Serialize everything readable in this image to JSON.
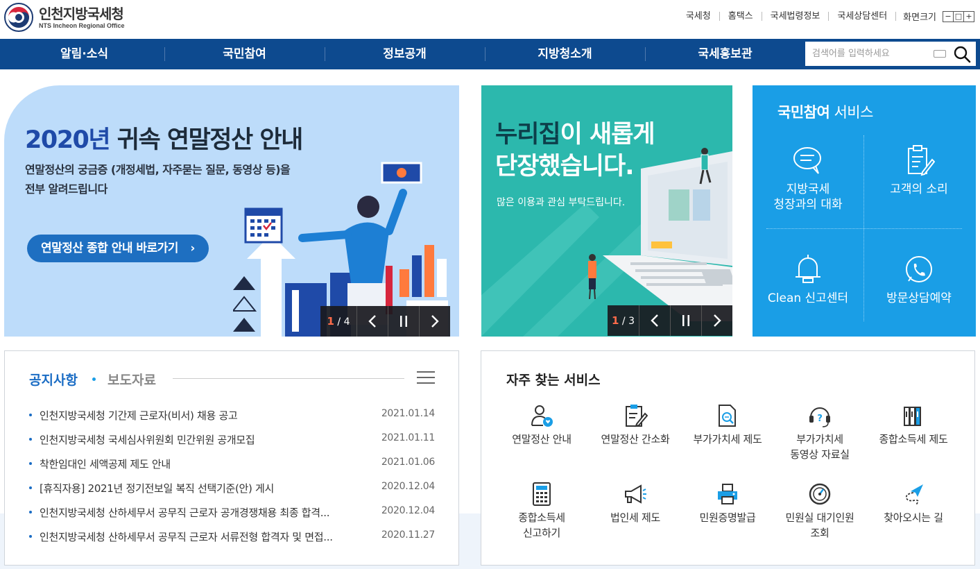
{
  "header": {
    "logo_title": "인천지방국세청",
    "logo_sub": "NTS Incheon Regional Office",
    "util_links": [
      "국세청",
      "홈택스",
      "국세법령정보",
      "국세상담센터"
    ],
    "font_size_label": "화면크기",
    "zoom_out": "−",
    "zoom_reset": "□",
    "zoom_in": "+"
  },
  "nav": {
    "items": [
      "알림·소식",
      "국민참여",
      "정보공개",
      "지방청소개",
      "국세홍보관"
    ],
    "search_placeholder": "검색어를 입력하세요"
  },
  "banner_main": {
    "title_year": "2020년",
    "title_rest": " 귀속 연말정산 안내",
    "desc_line1": "연말정산의 궁금증 (개정세법, 자주묻는 질문, 동영상 등)을",
    "desc_line2": "전부 알려드립니다",
    "button": "연말정산 종합 안내 바로가기",
    "page_current": "1",
    "page_total": "/ 4"
  },
  "banner_second": {
    "title_hl": "누리집",
    "title_rest1": "이 새롭게",
    "title_line2": "단장했습니다.",
    "desc": "많은 이용과 관심 부탁드립니다.",
    "page_current": "1",
    "page_total": "/ 3"
  },
  "service_box": {
    "title_bold": "국민참여",
    "title_rest": " 서비스",
    "items": [
      {
        "line1": "지방국세",
        "line2": "청장과의 대화",
        "icon": "speech-bubble-icon"
      },
      {
        "line1": "고객의 소리",
        "line2": "",
        "icon": "clipboard-pen-icon"
      },
      {
        "line1": "Clean 신고센터",
        "line2": "",
        "icon": "bell-icon"
      },
      {
        "line1": "방문상담예약",
        "line2": "",
        "icon": "phone-chat-icon"
      }
    ]
  },
  "notice": {
    "tab_active": "공지사항",
    "tab_inactive": "보도자료",
    "items": [
      {
        "title": "인천지방국세청 기간제 근로자(비서) 채용 공고",
        "date": "2021.01.14"
      },
      {
        "title": "인천지방국세청 국세심사위원회 민간위원 공개모집",
        "date": "2021.01.11"
      },
      {
        "title": "착한임대인 세액공제 제도 안내",
        "date": "2021.01.06"
      },
      {
        "title": "[휴직자용] 2021년 정기전보일 복직 선택기준(안) 게시",
        "date": "2020.12.04"
      },
      {
        "title": "인천지방국세청 산하세무서 공무직 근로자 공개경쟁채용 최종 합격...",
        "date": "2020.12.04"
      },
      {
        "title": "인천지방국세청 산하세무서 공무직 근로자 서류전형 합격자 및 면접...",
        "date": "2020.11.27"
      }
    ]
  },
  "frequent": {
    "title": "자주 찾는 서비스",
    "items": [
      {
        "line1": "연말정산 안내",
        "line2": "",
        "icon": "person-heart-icon"
      },
      {
        "line1": "연말정산 간소화",
        "line2": "",
        "icon": "document-pen-icon"
      },
      {
        "line1": "부가가치세 제도",
        "line2": "",
        "icon": "document-search-icon"
      },
      {
        "line1": "부가가치세",
        "line2": "동영상 자료실",
        "icon": "headset-help-icon"
      },
      {
        "line1": "종합소득세 제도",
        "line2": "",
        "icon": "binders-icon"
      },
      {
        "line1": "종합소득세",
        "line2": "신고하기",
        "icon": "calculator-icon"
      },
      {
        "line1": "법인세 제도",
        "line2": "",
        "icon": "megaphone-icon"
      },
      {
        "line1": "민원증명발급",
        "line2": "",
        "icon": "printer-icon"
      },
      {
        "line1": "민원실 대기인원",
        "line2": "조회",
        "icon": "gauge-icon"
      },
      {
        "line1": "찾아오시는 길",
        "line2": "",
        "icon": "paper-plane-icon"
      }
    ]
  },
  "colors": {
    "nav_bg": "#0d4a8f",
    "main_banner_bg": "#bddcfa",
    "second_banner_bg": "#2cb8ad",
    "service_box_bg": "#1a9ee6",
    "accent_blue": "#1a6cc4"
  }
}
